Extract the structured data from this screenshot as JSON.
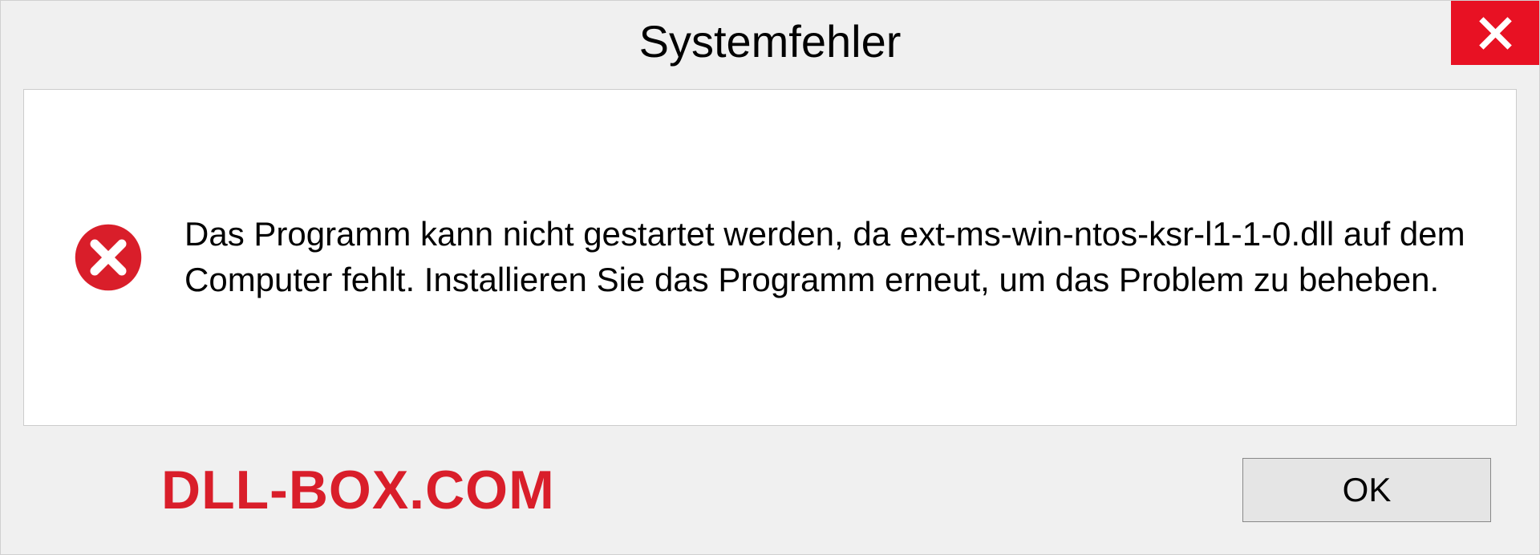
{
  "dialog": {
    "title": "Systemfehler",
    "message": "Das Programm kann nicht gestartet werden, da ext-ms-win-ntos-ksr-l1-1-0.dll auf dem Computer fehlt. Installieren Sie das Programm erneut, um das Problem zu beheben.",
    "ok_label": "OK"
  },
  "watermark": "DLL-BOX.COM"
}
